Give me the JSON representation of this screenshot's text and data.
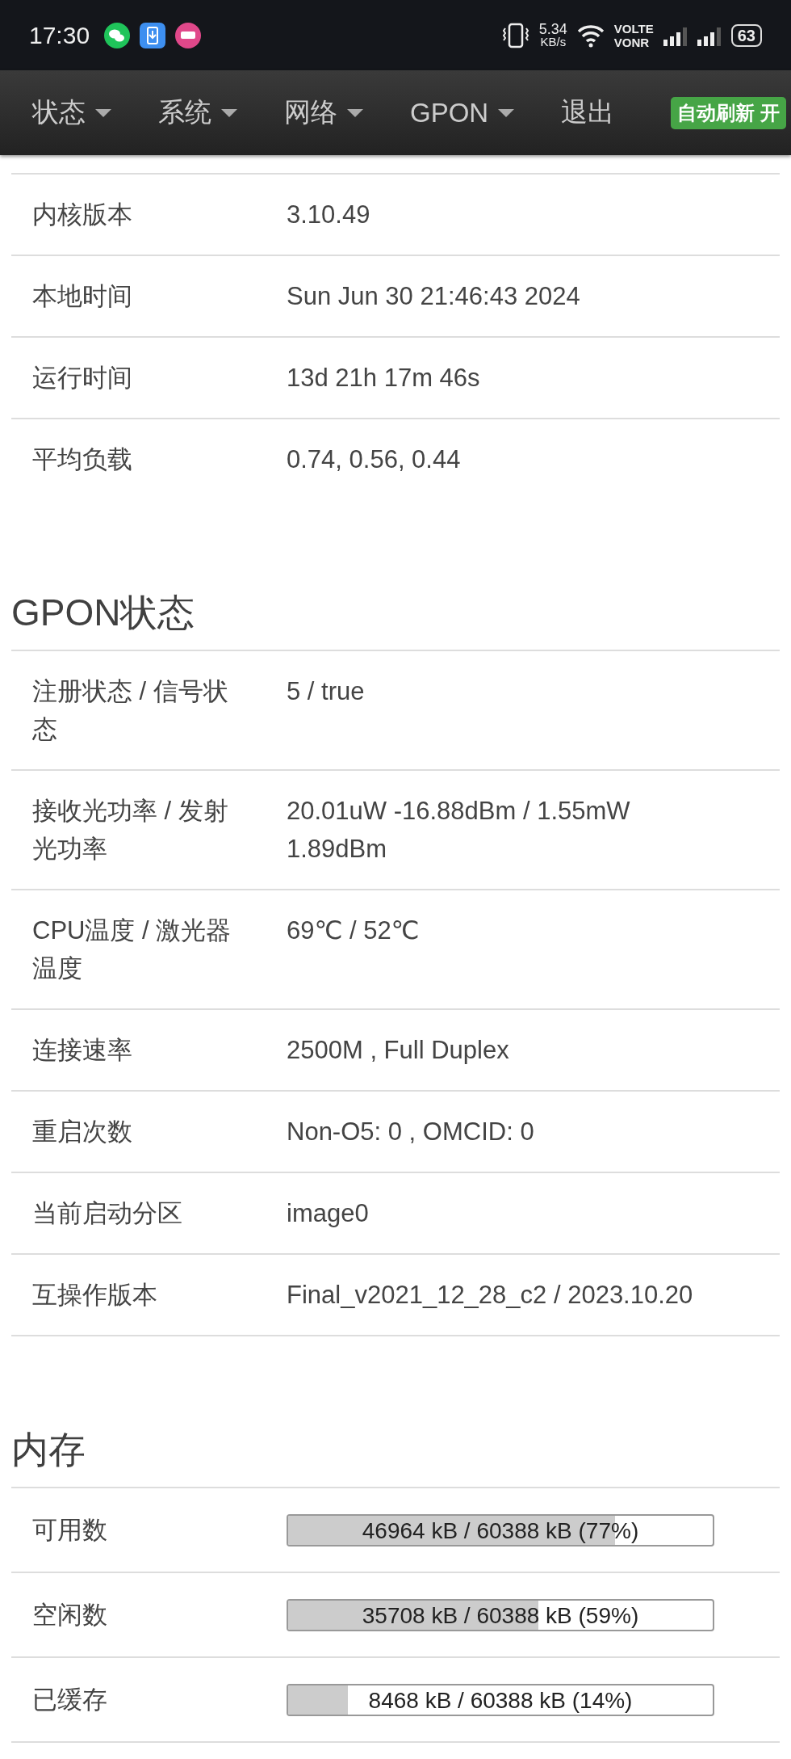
{
  "status_bar": {
    "time": "17:30",
    "speed": "5.34",
    "speed_unit": "KB/s",
    "volte": "VOLTE",
    "vonr": "VONR",
    "battery": "63"
  },
  "nav": {
    "items": [
      {
        "label": "状态",
        "dropdown": true
      },
      {
        "label": "系统",
        "dropdown": true
      },
      {
        "label": "网络",
        "dropdown": true
      },
      {
        "label": "GPON",
        "dropdown": true
      },
      {
        "label": "退出",
        "dropdown": false
      }
    ],
    "badge": "自动刷新 开"
  },
  "sections": [
    {
      "rows": [
        {
          "label": "内核版本",
          "value": "3.10.49"
        },
        {
          "label": "本地时间",
          "value": "Sun Jun 30 21:46:43 2024"
        },
        {
          "label": "运行时间",
          "value": "13d 21h 17m 46s"
        },
        {
          "label": "平均负载",
          "value": "0.74, 0.56, 0.44"
        }
      ]
    },
    {
      "title": "GPON状态",
      "rows": [
        {
          "label": "注册状态 / 信号状态",
          "value": "5 / true"
        },
        {
          "label": "接收光功率 / 发射光功率",
          "value": "20.01uW -16.88dBm / 1.55mW 1.89dBm"
        },
        {
          "label": "CPU温度 / 激光器温度",
          "value": "69℃ / 52℃"
        },
        {
          "label": "连接速率",
          "value": "2500M , Full Duplex"
        },
        {
          "label": "重启次数",
          "value": "Non-O5: 0 , OMCID: 0"
        },
        {
          "label": "当前启动分区",
          "value": "image0"
        },
        {
          "label": "互操作版本",
          "value": "Final_v2021_12_28_c2 / 2023.10.20"
        }
      ]
    },
    {
      "title": "内存",
      "rows": [
        {
          "label": "可用数",
          "value": "46964 kB / 60388 kB (77%)",
          "level": 0.77
        },
        {
          "label": "空闲数",
          "value": "35708 kB / 60388 kB (59%)",
          "level": 0.59
        },
        {
          "label": "已缓存",
          "value": "8468 kB / 60388 kB (14%)",
          "level": 0.14
        }
      ]
    }
  ]
}
